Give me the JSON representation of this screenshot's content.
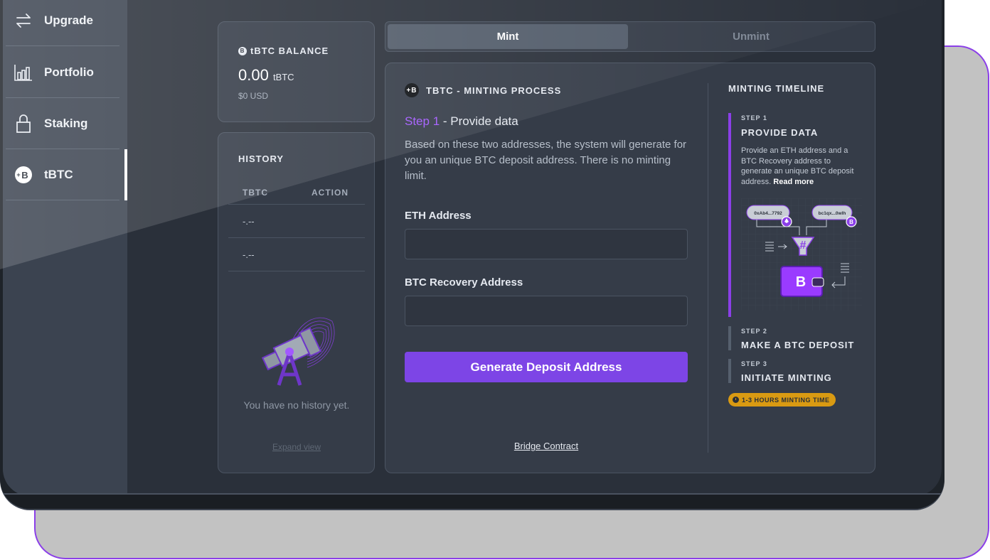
{
  "sidebar": {
    "items": [
      {
        "label": "Upgrade",
        "icon": "arrows-swap-icon"
      },
      {
        "label": "Portfolio",
        "icon": "bar-chart-icon"
      },
      {
        "label": "Staking",
        "icon": "lock-icon"
      },
      {
        "label": "tBTC",
        "icon": "tbtc-icon",
        "active": true
      }
    ]
  },
  "balance": {
    "title": "tBTC BALANCE",
    "value": "0.00",
    "unit": "tBTC",
    "usd": "$0 USD"
  },
  "history": {
    "title": "HISTORY",
    "columns": [
      "TBTC",
      "ACTION"
    ],
    "rows": [
      "-.--",
      "-.--"
    ],
    "empty_text": "You have no history yet.",
    "expand_label": "Expand view"
  },
  "tabs": {
    "mint": "Mint",
    "unmint": "Unmint",
    "active": "mint"
  },
  "mint": {
    "title": "TBTC - MINTING PROCESS",
    "step_label": "Step 1",
    "step_text": " - Provide data",
    "description": "Based on these two addresses, the system will generate for you an unique BTC deposit address. There is no minting limit.",
    "eth_label": "ETH Address",
    "eth_value": "",
    "btc_label": "BTC Recovery Address",
    "btc_value": "",
    "button_label": "Generate Deposit Address",
    "bridge_link": "Bridge Contract"
  },
  "timeline": {
    "title": "MINTING TIMELINE",
    "steps": [
      {
        "step": "STEP 1",
        "name": "PROVIDE DATA",
        "desc": "Provide an ETH address and a BTC Recovery address to generate an unique BTC deposit address.",
        "more": "Read more"
      },
      {
        "step": "STEP 2",
        "name": "MAKE A BTC DEPOSIT"
      },
      {
        "step": "STEP 3",
        "name": "INITIATE MINTING"
      }
    ],
    "illustration": {
      "eth_pill": "0xAb4...7792",
      "btc_pill": "bc1qx...0wlh",
      "hash": "#",
      "wallet": "B"
    },
    "badge": "1-3 HOURS MINTING TIME"
  },
  "colors": {
    "accent": "#7d45e6",
    "accent_light": "#a259ff",
    "badge": "#d99a12",
    "frame": "#8b3fe8"
  }
}
